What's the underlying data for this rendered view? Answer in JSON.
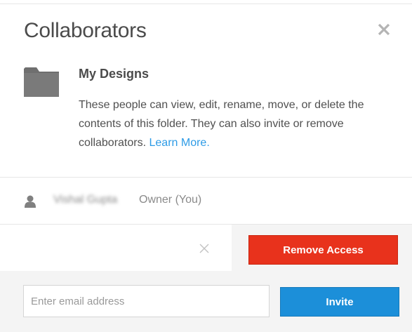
{
  "dialog": {
    "title": "Collaborators",
    "close_icon": "close-icon"
  },
  "folder": {
    "icon": "folder-icon",
    "name": "My Designs",
    "description": "These people can view, edit, rename, move, or delete the contents of this folder. They can also invite or remove collaborators. ",
    "learn_more_label": "Learn More."
  },
  "collaborators": [
    {
      "icon": "person-icon",
      "name": "Vishal Gupta",
      "role": "Owner (You)"
    }
  ],
  "actions": {
    "cancel_icon": "close-icon",
    "remove_access_label": "Remove Access"
  },
  "invite": {
    "email_value": "",
    "email_placeholder": "Enter email address",
    "invite_label": "Invite"
  },
  "colors": {
    "remove_button": "#e8321c",
    "invite_button": "#1c8fd9",
    "link": "#2d9be6",
    "footer_background": "#f4f4f4"
  }
}
